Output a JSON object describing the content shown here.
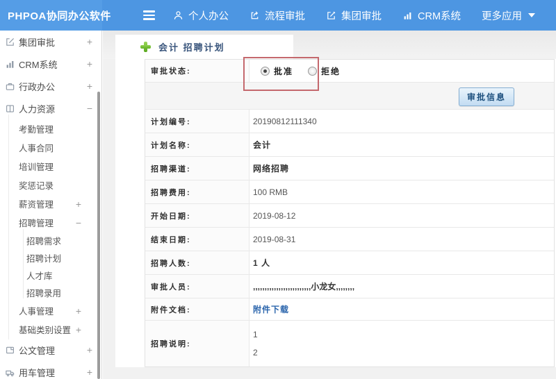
{
  "topbar": {
    "logo": "PHPOA协同办公软件",
    "items": [
      {
        "label": "个人办公",
        "icon": "user-icon"
      },
      {
        "label": "流程审批",
        "icon": "flow-icon"
      },
      {
        "label": "集团审批",
        "icon": "edit-icon"
      },
      {
        "label": "CRM系统",
        "icon": "bar-chart-icon"
      },
      {
        "label": "更多应用",
        "icon": "caret-down-icon"
      }
    ]
  },
  "sidebar": {
    "items": [
      {
        "label": "集团审批",
        "expander": "+"
      },
      {
        "label": "CRM系统",
        "expander": "+"
      },
      {
        "label": "行政办公",
        "expander": "+"
      },
      {
        "label": "人力资源",
        "expander": "−"
      },
      {
        "label": "考勤管理"
      },
      {
        "label": "人事合同"
      },
      {
        "label": "培训管理"
      },
      {
        "label": "奖惩记录"
      },
      {
        "label": "薪资管理",
        "expander": "+"
      },
      {
        "label": "招聘管理",
        "expander": "−"
      },
      {
        "label": "招聘需求"
      },
      {
        "label": "招聘计划"
      },
      {
        "label": "人才库"
      },
      {
        "label": "招聘录用"
      },
      {
        "label": "人事管理",
        "expander": "+"
      },
      {
        "label": "基础类别设置",
        "expander": "+"
      },
      {
        "label": "公文管理",
        "expander": "+"
      },
      {
        "label": "用车管理",
        "expander": "+"
      }
    ]
  },
  "main": {
    "page_title": "会计 招聘计划",
    "approval": {
      "label": "审批状态:",
      "approve_label": "批准",
      "reject_label": "拒绝",
      "selected": "批准",
      "info_button": "审批信息"
    },
    "fields": [
      {
        "label": "计划编号:",
        "value": "20190812111340"
      },
      {
        "label": "计划名称:",
        "value": "会计"
      },
      {
        "label": "招聘渠道:",
        "value": "网络招聘"
      },
      {
        "label": "招聘费用:",
        "value": "100 RMB"
      },
      {
        "label": "开始日期:",
        "value": "2019-08-12"
      },
      {
        "label": "结束日期:",
        "value": "2019-08-31"
      },
      {
        "label": "招聘人数:",
        "value": "1 人"
      },
      {
        "label": "审批人员:",
        "value": ",,,,,,,,,,,,,,,,,,,,,,,,,小龙女,,,,,,,,"
      },
      {
        "label": "附件文档:",
        "value": "附件下载"
      }
    ],
    "description": {
      "label": "招聘说明:",
      "line1": "1",
      "line2": "2"
    }
  },
  "colors": {
    "topbar_blue": "#4D96E2",
    "annotation_red": "#C4686D",
    "link_blue": "#2B65AC",
    "title_navy": "#39557C",
    "plus_green": "#63B028"
  }
}
